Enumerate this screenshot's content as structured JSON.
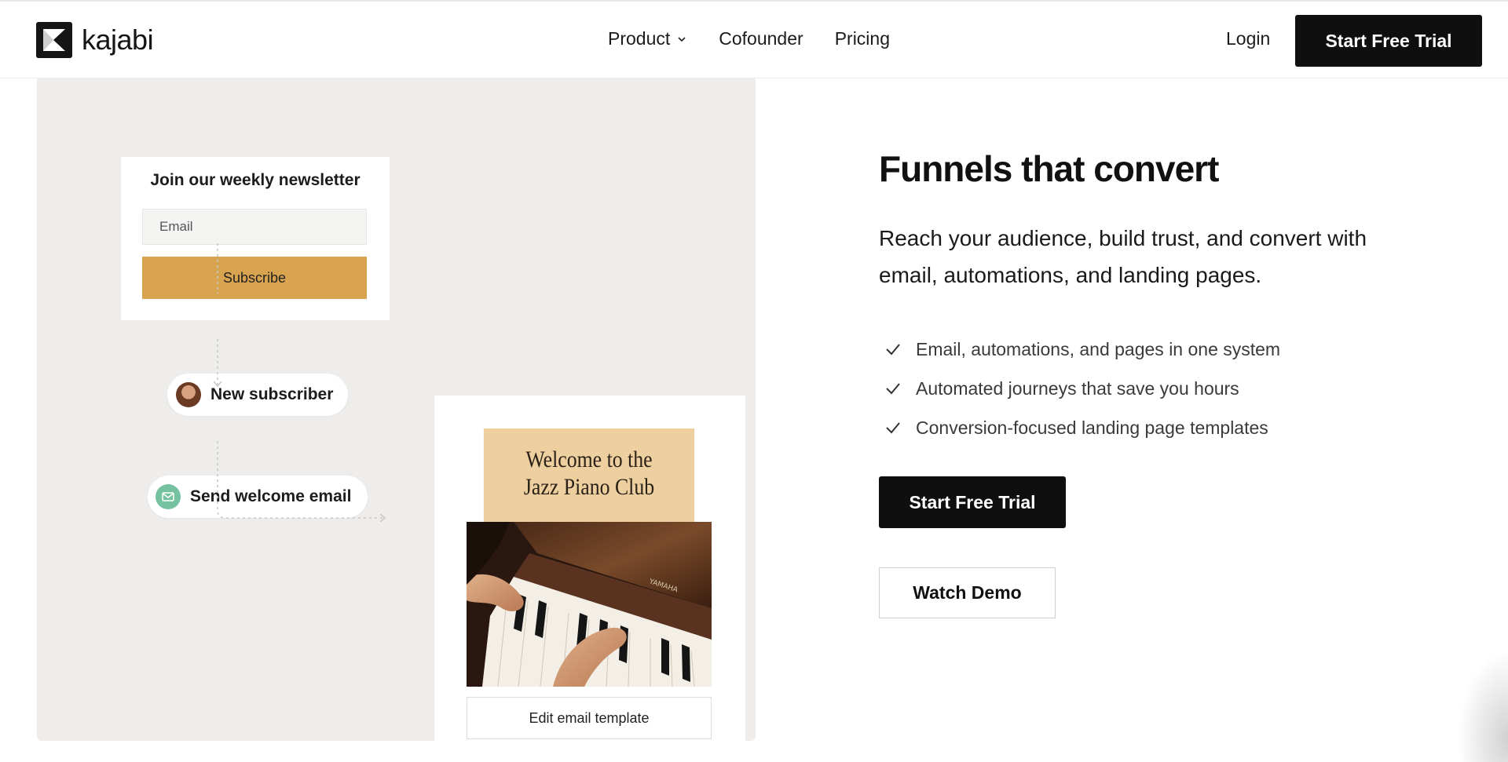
{
  "brand": {
    "name": "kajabi",
    "logo_icon": "kajabi-k-mark-icon"
  },
  "nav": {
    "items": [
      {
        "label": "Product",
        "has_dropdown": true
      },
      {
        "label": "Cofounder"
      },
      {
        "label": "Pricing"
      }
    ],
    "login_label": "Login",
    "cta_label": "Start Free Trial"
  },
  "illustration": {
    "newsletter": {
      "title": "Join our weekly newsletter",
      "email_placeholder": "Email",
      "subscribe_label": "Subscribe"
    },
    "steps": [
      {
        "label": "New subscriber",
        "icon": "avatar"
      },
      {
        "label": "Send welcome email",
        "icon": "mail-icon"
      }
    ],
    "email_preview": {
      "headline_line1": "Welcome to the",
      "headline_line2": "Jazz Piano Club",
      "photo_brand_text": "YAMAHA",
      "edit_label": "Edit email template"
    }
  },
  "content": {
    "headline": "Funnels that convert",
    "lede": "Reach your audience, build trust, and convert with email, automations, and landing pages.",
    "features": [
      "Email, automations, and pages in one system",
      "Automated journeys that save you hours",
      "Conversion-focused landing page templates"
    ],
    "primary_cta": "Start Free Trial",
    "secondary_cta": "Watch Demo"
  },
  "colors": {
    "accent_gold": "#d9a450",
    "email_header_bg": "#eecf9f",
    "panel_bg": "#eeedeb",
    "button_dark": "#0f0f0f",
    "mail_icon_green": "#76c2a0"
  }
}
